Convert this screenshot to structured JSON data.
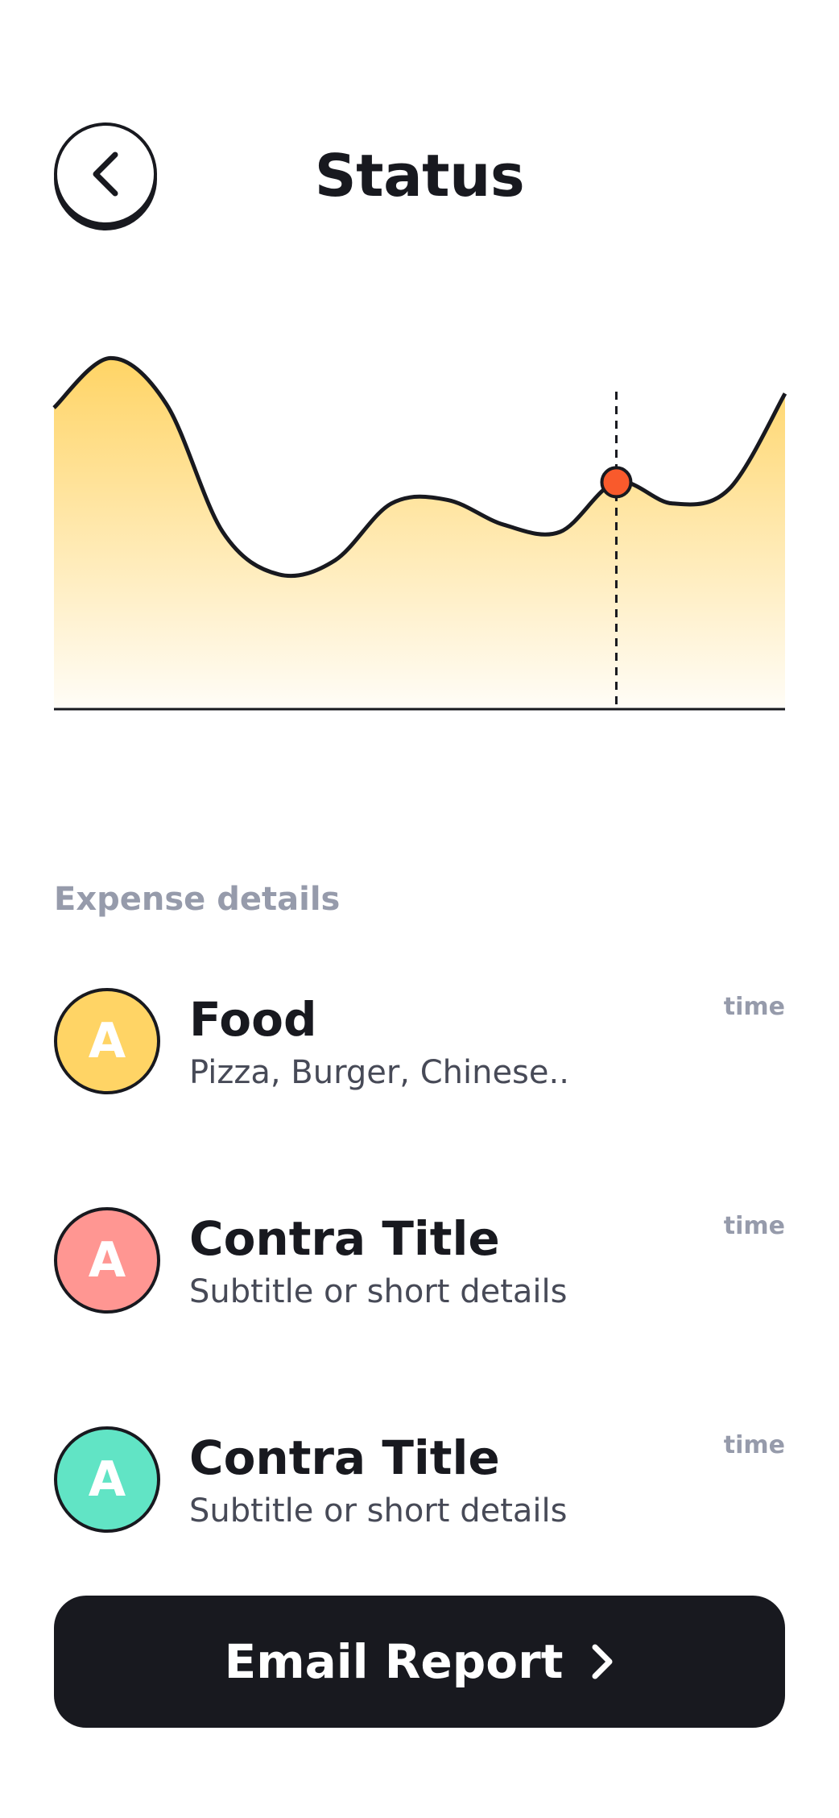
{
  "header": {
    "title": "Status"
  },
  "icons": {
    "back": "chevron-left-icon",
    "arrow": "chevron-right-icon"
  },
  "colors": {
    "ink": "#18191f",
    "muted": "#969bab",
    "gradient_top": "#ffd465",
    "marker": "#f95a2c",
    "avatar_yellow": "#ffd465",
    "avatar_red": "#ff9692",
    "avatar_green": "#61e4c5"
  },
  "chart_data": {
    "type": "area",
    "series": [
      {
        "y": [
          0.85,
          0.99,
          0.86,
          0.5,
          0.38,
          0.42,
          0.58,
          0.59,
          0.52,
          0.5,
          0.64,
          0.58,
          0.62,
          0.89
        ]
      }
    ],
    "highlight_index": 10,
    "grid": false,
    "title": "",
    "xlabel": "",
    "ylabel": ""
  },
  "expense": {
    "section_label": "Expense details",
    "items": [
      {
        "initial": "A",
        "title": "Food",
        "subtitle": "Pizza, Burger, Chinese..",
        "time": "time",
        "color": "#ffd465"
      },
      {
        "initial": "A",
        "title": "Contra Title",
        "subtitle": "Subtitle or short details",
        "time": "time",
        "color": "#ff9692"
      },
      {
        "initial": "A",
        "title": "Contra Title",
        "subtitle": "Subtitle or short details",
        "time": "time",
        "color": "#61e4c5"
      }
    ]
  },
  "footer": {
    "button_label": "Email Report"
  }
}
